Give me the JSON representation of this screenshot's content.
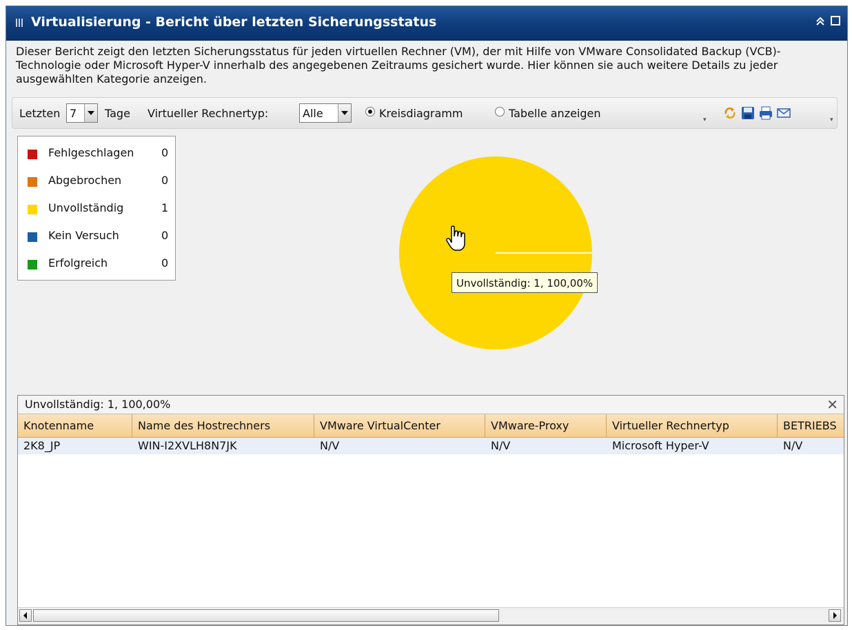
{
  "window": {
    "title": "Virtualisierung - Bericht über letzten Sicherungsstatus"
  },
  "description": "Dieser Bericht zeigt den letzten Sicherungsstatus für jeden virtuellen Rechner (VM), der mit Hilfe von VMware Consolidated Backup (VCB)-Technologie oder Microsoft Hyper-V innerhalb des angegebenen Zeitraums gesichert wurde. Hier können sie auch weitere Details zu jeder ausgewählten Kategorie anzeigen.",
  "toolbar": {
    "last_label": "Letzten",
    "days_value": "7",
    "days_label": "Tage",
    "vm_type_label": "Virtueller Rechnertyp:",
    "vm_type_value": "Alle",
    "pie_option": "Kreisdiagramm",
    "table_option": "Tabelle anzeigen",
    "selected_view": "Kreisdiagramm",
    "icons": [
      "refresh-icon",
      "save-icon",
      "print-icon",
      "email-icon"
    ]
  },
  "legend": [
    {
      "label": "Fehlgeschlagen",
      "count": "0",
      "color": "#cc1111"
    },
    {
      "label": "Abgebrochen",
      "count": "0",
      "color": "#dd7711"
    },
    {
      "label": "Unvollständig",
      "count": "1",
      "color": "#ffd700"
    },
    {
      "label": "Kein Versuch",
      "count": "0",
      "color": "#1a5ea6"
    },
    {
      "label": "Erfolgreich",
      "count": "0",
      "color": "#1a9a1a"
    }
  ],
  "chart_data": {
    "type": "pie",
    "categories": [
      "Fehlgeschlagen",
      "Abgebrochen",
      "Unvollständig",
      "Kein Versuch",
      "Erfolgreich"
    ],
    "values": [
      0,
      0,
      1,
      0,
      0
    ],
    "colors": [
      "#cc1111",
      "#dd7711",
      "#ffd700",
      "#1a5ea6",
      "#1a9a1a"
    ],
    "legend_position": "top-left",
    "tooltip": "Unvollständig: 1, 100,00%"
  },
  "detail": {
    "title": "Unvollständig: 1, 100,00%",
    "columns": [
      "Knotenname",
      "Name des Hostrechners",
      "VMware VirtualCenter",
      "VMware-Proxy",
      "Virtueller Rechnertyp",
      "BETRIEBS"
    ],
    "rows": [
      [
        "2K8_JP",
        "WIN-I2XVLH8N7JK",
        "N/V",
        "N/V",
        "Microsoft Hyper-V",
        "N/V"
      ]
    ]
  }
}
